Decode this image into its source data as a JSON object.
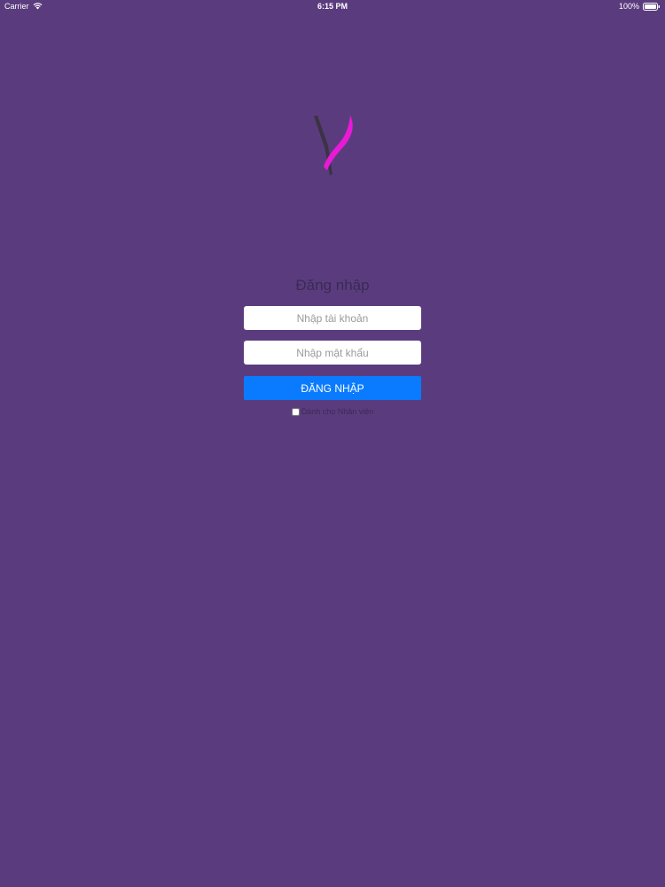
{
  "colors": {
    "background": "#5a3c7e",
    "primary_button": "#0a7bff",
    "logo_pink": "#e81ad6",
    "logo_dark": "#3b3345"
  },
  "status_bar": {
    "carrier": "Carrier",
    "time": "6:15 PM",
    "battery": "100%"
  },
  "logo": {
    "icon": "brand-logo-icon"
  },
  "login": {
    "title": "Đăng nhập",
    "username_placeholder": "Nhập tài khoản",
    "password_placeholder": "Nhập mật khẩu",
    "submit_label": "ĐĂNG NHẬP",
    "staff_checkbox_label": "Dành cho Nhân viên"
  }
}
